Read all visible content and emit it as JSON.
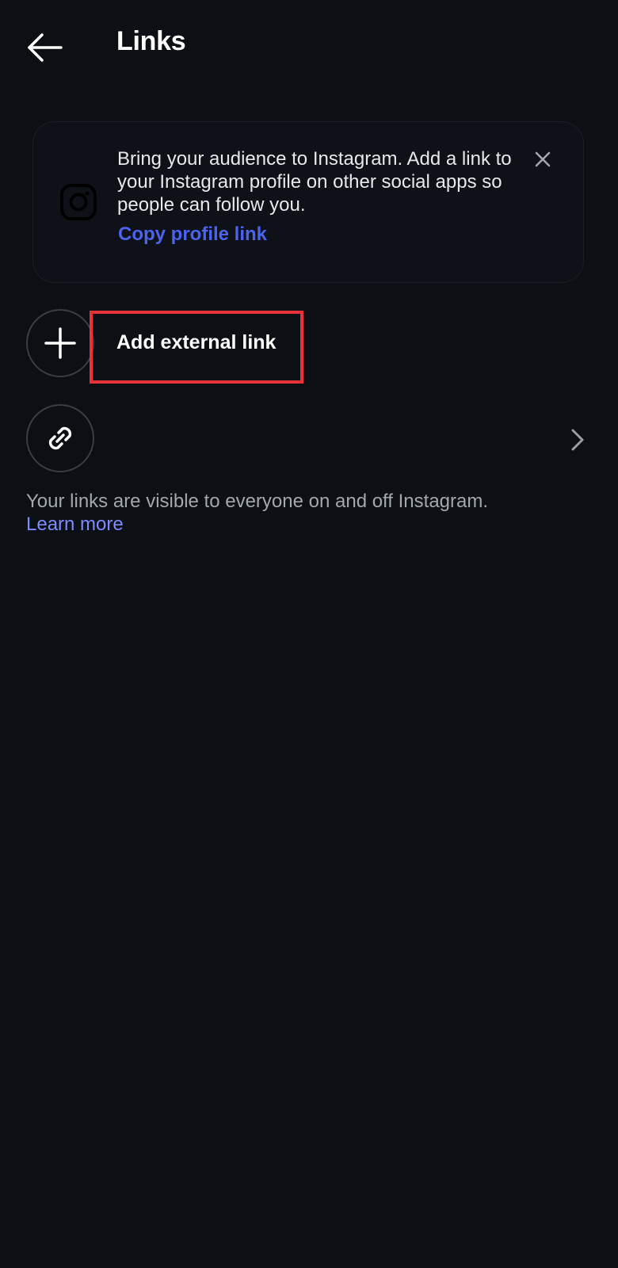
{
  "header": {
    "title": "Links",
    "back_icon": "back-arrow-icon"
  },
  "promo": {
    "text": "Bring your audience to Instagram. Add a link to your Instagram profile on other social apps so people can follow you.",
    "link_label": "Copy profile link",
    "icon": "instagram-icon",
    "close_icon": "close-icon"
  },
  "list": {
    "add_label": "Add external link",
    "add_icon": "plus-icon",
    "link_icon": "link-icon",
    "chevron_icon": "chevron-right-icon"
  },
  "footer": {
    "text": "Your links are visible to everyone on and off Instagram.",
    "learn_more": "Learn more"
  },
  "colors": {
    "background": "#0c0f14",
    "accent": "#4a63f0",
    "link_secondary": "#7b8cff",
    "highlight": "#e8323a"
  }
}
